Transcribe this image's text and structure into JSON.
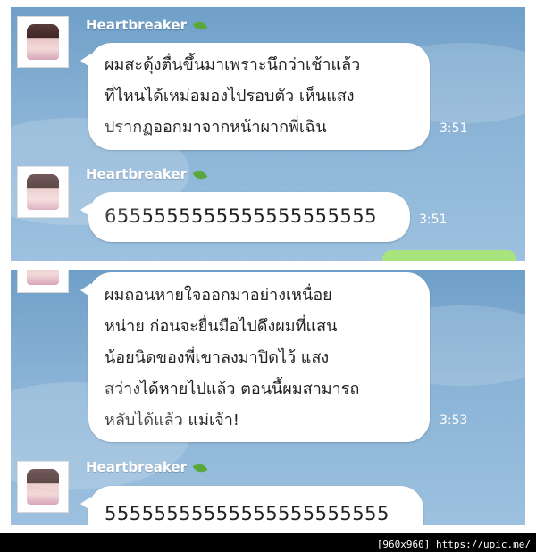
{
  "panels": [
    {
      "messages": [
        {
          "sender": "Heartbreaker",
          "text": "ผมสะดุ้งตื่นขึ้นมาเพราะนึกว่าเช้าแล้ว\nที่ไหนได้เหม่อมองไปรอบตัว เห็นแสง\nปรากฏออกมาจากหน้าผากพี่เฉิน",
          "time": "3:51"
        },
        {
          "sender": "Heartbreaker",
          "text": "6555555555555555555555",
          "time": "3:51"
        }
      ]
    },
    {
      "messages": [
        {
          "text": "ผมถอนหายใจออกมาอย่างเหนื่อย\nหน่าย ก่อนจะยื่นมือไปดึงผมที่แสน\nน้อยนิดของพี่เขาลงมาปิดไว้ แสง\nสว่างได้หายไปแล้ว ตอนนี้ผมสามารถ\nหลับได้แล้ว แม่เจ้า!",
          "time": "3:53"
        },
        {
          "sender": "Heartbreaker",
          "text": "55555555555555555555555",
          "time": ""
        }
      ]
    }
  ],
  "footer": "[960x960] https://upic.me/",
  "colors": {
    "bubble": "#ffffff",
    "background": "#8ab3d6",
    "leaf": "#5aa83a",
    "outgoing": "#a8e37c"
  },
  "icons": {
    "status": "leaf-icon"
  }
}
